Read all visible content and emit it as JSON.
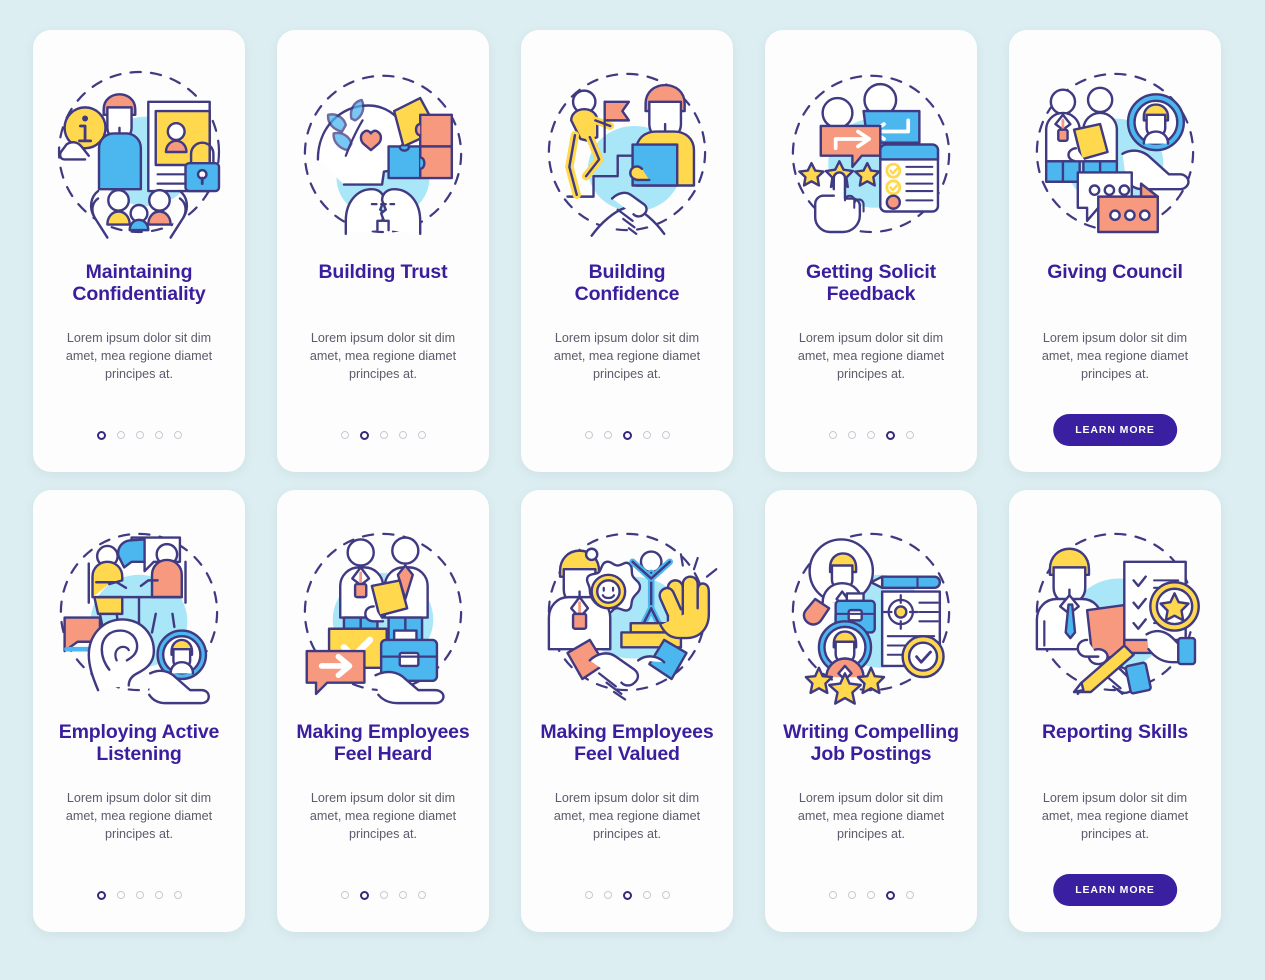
{
  "background_color": "#dceef1",
  "palette": {
    "outline": "#3f3a82",
    "title": "#3b1e9e",
    "body_text": "#5b5b6b",
    "yellow": "#ffd84d",
    "blue": "#4cb6ef",
    "light_blue": "#a9e6f7",
    "coral": "#f6997f",
    "button": "#3a1fa0",
    "dot_inactive": "#c9c9d4",
    "dot_active": "#342a7a",
    "card_bg": "#fdfdfd"
  },
  "shared": {
    "body_text": "Lorem ipsum dolor sit dim amet, mea regione diamet principes at.",
    "learn_more_label": "LEARN MORE"
  },
  "cards": [
    {
      "id": "maintaining-confidentiality",
      "title": "Maintaining Confidentiality",
      "body": "Lorem ipsum dolor sit dim amet, mea regione diamet principes at.",
      "dots_total": 5,
      "dot_active": 1,
      "has_button": false,
      "illustration": "confidentiality-illustration"
    },
    {
      "id": "building-trust",
      "title": "Building Trust",
      "body": "Lorem ipsum dolor sit dim amet, mea regione diamet principes at.",
      "dots_total": 5,
      "dot_active": 2,
      "has_button": false,
      "illustration": "trust-illustration"
    },
    {
      "id": "building-confidence",
      "title": "Building Confidence",
      "body": "Lorem ipsum dolor sit dim amet, mea regione diamet principes at.",
      "dots_total": 5,
      "dot_active": 3,
      "has_button": false,
      "illustration": "confidence-illustration"
    },
    {
      "id": "getting-solicit-feedback",
      "title": "Getting Solicit Feedback",
      "body": "Lorem ipsum dolor sit dim amet, mea regione diamet principes at.",
      "dots_total": 5,
      "dot_active": 4,
      "has_button": false,
      "illustration": "feedback-illustration"
    },
    {
      "id": "giving-council",
      "title": "Giving Council",
      "body": "Lorem ipsum dolor sit dim amet, mea regione diamet principes at.",
      "dots_total": 0,
      "dot_active": 0,
      "has_button": true,
      "button_label": "LEARN MORE",
      "illustration": "council-illustration"
    },
    {
      "id": "employing-active-listening",
      "title": "Employing Active Listening",
      "body": "Lorem ipsum dolor sit dim amet, mea regione diamet principes at.",
      "dots_total": 5,
      "dot_active": 1,
      "has_button": false,
      "illustration": "listening-illustration"
    },
    {
      "id": "making-employees-feel-heard",
      "title": "Making Employees Feel Heard",
      "body": "Lorem ipsum dolor sit dim amet, mea regione diamet principes at.",
      "dots_total": 5,
      "dot_active": 2,
      "has_button": false,
      "illustration": "feel-heard-illustration"
    },
    {
      "id": "making-employees-feel-valued",
      "title": "Making Employees Feel Valued",
      "body": "Lorem ipsum dolor sit dim amet, mea regione diamet principes at.",
      "dots_total": 5,
      "dot_active": 3,
      "has_button": false,
      "illustration": "feel-valued-illustration"
    },
    {
      "id": "writing-compelling-job-postings",
      "title": "Writing Compelling Job Postings",
      "body": "Lorem ipsum dolor sit dim amet, mea regione diamet principes at.",
      "dots_total": 5,
      "dot_active": 4,
      "has_button": false,
      "illustration": "job-postings-illustration"
    },
    {
      "id": "reporting-skills",
      "title": "Reporting Skills",
      "body": "Lorem ipsum dolor sit dim amet, mea regione diamet principes at.",
      "dots_total": 0,
      "dot_active": 0,
      "has_button": true,
      "button_label": "LEARN MORE",
      "illustration": "reporting-illustration"
    }
  ]
}
